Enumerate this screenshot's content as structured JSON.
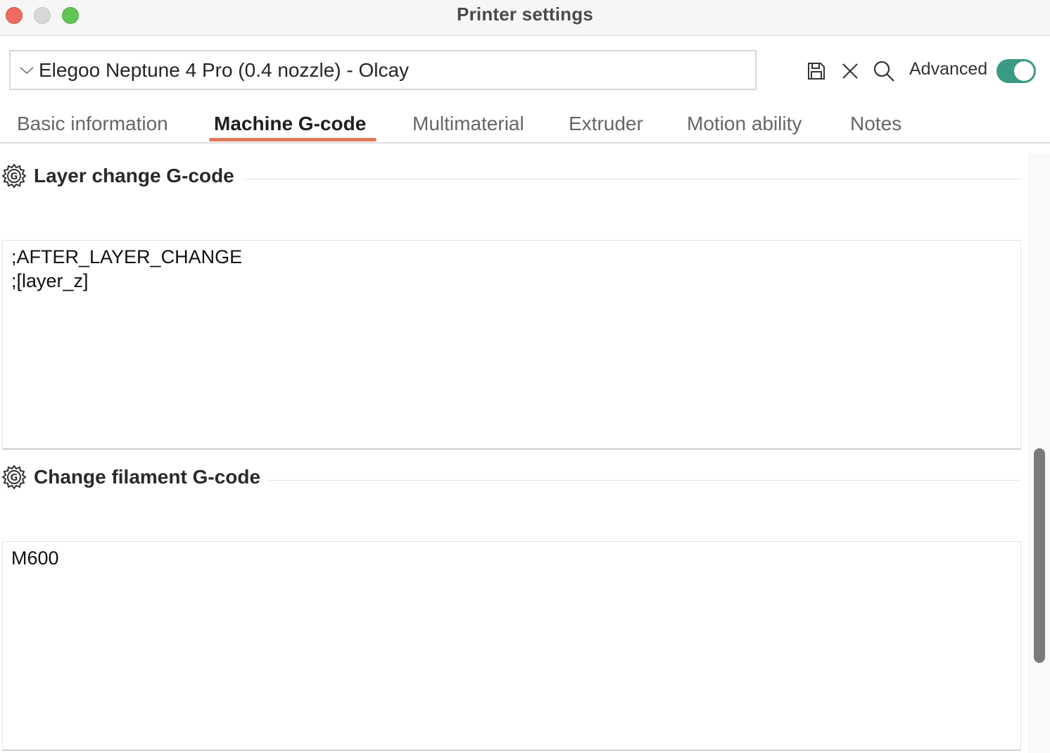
{
  "window": {
    "title": "Printer settings"
  },
  "preset": {
    "selected": "Elegoo Neptune 4 Pro (0.4 nozzle) - Olcay"
  },
  "toolbar": {
    "save_icon": "save-icon",
    "discard_icon": "close-icon",
    "search_icon": "search-icon",
    "advanced_label": "Advanced",
    "advanced_enabled": true,
    "toggle_color": "#3a9a84"
  },
  "tabs": [
    {
      "label": "Basic information",
      "active": false
    },
    {
      "label": "Machine G-code",
      "active": true
    },
    {
      "label": "Multimaterial",
      "active": false
    },
    {
      "label": "Extruder",
      "active": false
    },
    {
      "label": "Motion ability",
      "active": false
    },
    {
      "label": "Notes",
      "active": false
    }
  ],
  "accent_color": "#e07a5a",
  "sections": [
    {
      "title": "Layer change G-code",
      "icon": "gcode-gear-icon",
      "code": ";AFTER_LAYER_CHANGE\n;[layer_z]"
    },
    {
      "title": "Change filament G-code",
      "icon": "gcode-gear-icon",
      "code": "M600"
    }
  ]
}
